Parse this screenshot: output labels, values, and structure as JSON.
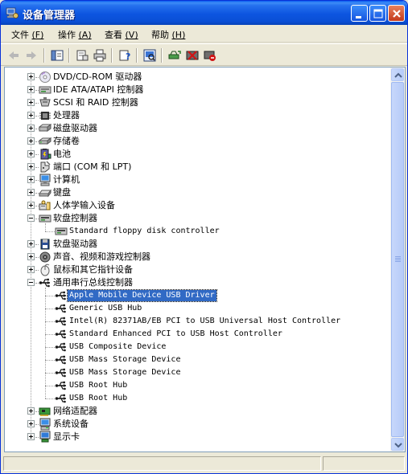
{
  "window": {
    "title": "设备管理器",
    "accent": "#0a4fd6"
  },
  "menu": [
    {
      "label": "文件",
      "key": "(F)"
    },
    {
      "label": "操作",
      "key": "(A)"
    },
    {
      "label": "查看",
      "key": "(V)"
    },
    {
      "label": "帮助",
      "key": "(H)"
    }
  ],
  "toolbar": {
    "buttons": [
      "back-icon",
      "forward-icon",
      "show-hide-tree-icon",
      "properties-icon",
      "print-icon",
      "help-icon",
      "scan-hardware-icon",
      "update-driver-icon",
      "uninstall-icon",
      "disable-icon"
    ]
  },
  "tree": {
    "categories": [
      {
        "label": "DVD/CD-ROM 驱动器",
        "icon": "cdrom-icon"
      },
      {
        "label": "IDE ATA/ATAPI 控制器",
        "icon": "ide-controller-icon"
      },
      {
        "label": "SCSI 和 RAID 控制器",
        "icon": "scsi-icon"
      },
      {
        "label": "处理器",
        "icon": "processor-icon"
      },
      {
        "label": "磁盘驱动器",
        "icon": "disk-drive-icon"
      },
      {
        "label": "存储卷",
        "icon": "storage-volume-icon"
      },
      {
        "label": "电池",
        "icon": "battery-icon"
      },
      {
        "label": "端口 (COM 和 LPT)",
        "icon": "port-icon"
      },
      {
        "label": "计算机",
        "icon": "computer-icon"
      },
      {
        "label": "键盘",
        "icon": "keyboard-icon"
      },
      {
        "label": "人体学输入设备",
        "icon": "hid-icon"
      },
      {
        "label": "软盘控制器",
        "icon": "floppy-controller-icon",
        "expanded": true,
        "children": [
          "Standard floppy disk controller"
        ]
      },
      {
        "label": "软盘驱动器",
        "icon": "floppy-drive-icon"
      },
      {
        "label": "声音、视频和游戏控制器",
        "icon": "sound-icon"
      },
      {
        "label": "鼠标和其它指针设备",
        "icon": "mouse-icon"
      },
      {
        "label": "通用串行总线控制器",
        "icon": "usb-icon",
        "expanded": true,
        "children": [
          "Apple Mobile Device USB Driver",
          "Generic USB Hub",
          "Intel(R) 82371AB/EB PCI to USB Universal Host Controller",
          "Standard Enhanced PCI to USB Host Controller",
          "USB Composite Device",
          "USB Mass Storage Device",
          "USB Mass Storage Device",
          "USB Root Hub",
          "USB Root Hub"
        ]
      },
      {
        "label": "网络适配器",
        "icon": "network-adapter-icon"
      },
      {
        "label": "系统设备",
        "icon": "system-device-icon"
      },
      {
        "label": "显示卡",
        "icon": "display-adapter-icon"
      }
    ],
    "selected": "Apple Mobile Device USB Driver"
  }
}
